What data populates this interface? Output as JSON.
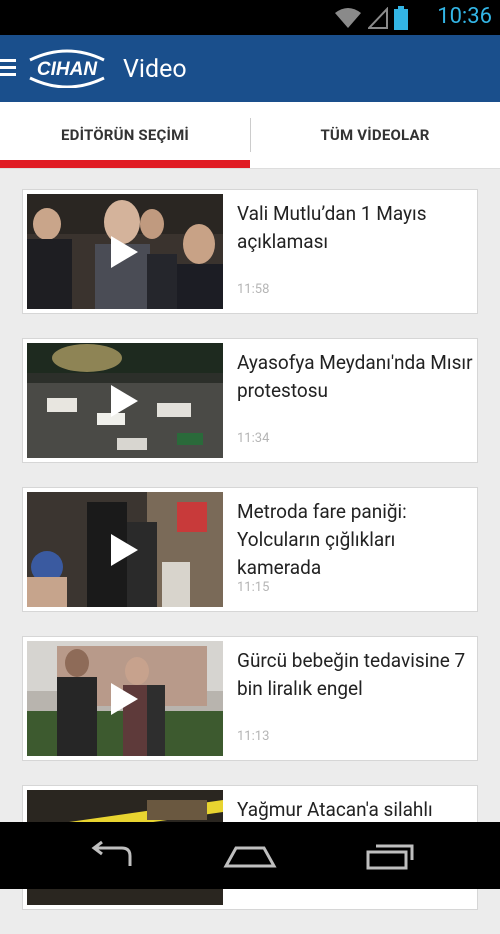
{
  "status_bar": {
    "time": "10:36",
    "icons": [
      "wifi-icon",
      "cell-signal-icon",
      "battery-icon"
    ]
  },
  "app_bar": {
    "logo_text": "CIHAN",
    "title": "Video"
  },
  "tabs": [
    {
      "label": "EDİTÖRÜN SEÇİMİ",
      "selected": true
    },
    {
      "label": "TÜM VİDEOLAR",
      "selected": false
    }
  ],
  "videos": [
    {
      "title": "Vali Mutlu’dan 1 Mayıs açıklaması",
      "time": "11:58"
    },
    {
      "title": "Ayasofya Meydanı'nda Mısır protestosu",
      "time": "11:34"
    },
    {
      "title": "Metroda fare paniği: Yolcuların çığlıkları kamerada",
      "time": "11:15"
    },
    {
      "title": "Gürcü bebeğin tedavisine 7 bin liralık engel",
      "time": "11:13"
    },
    {
      "title": "Yağmur Atacan'a silahlı",
      "time": ""
    }
  ],
  "nav_bar": {
    "icons": [
      "back-icon",
      "home-icon",
      "recents-icon"
    ]
  },
  "colors": {
    "app_bar": "#1a4f8c",
    "tab_indicator": "#e01c24",
    "status_accent": "#33b5e5"
  }
}
